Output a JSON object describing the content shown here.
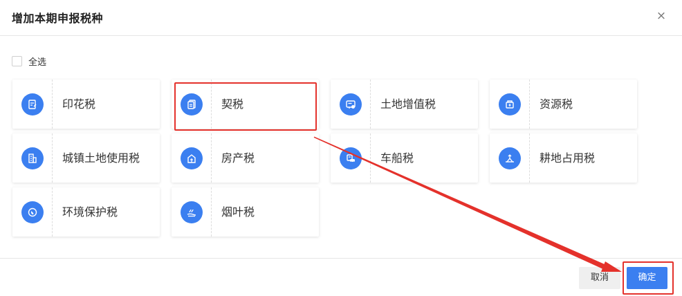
{
  "dialog": {
    "title": "增加本期申报税种",
    "close_glyph": "×"
  },
  "select_all": {
    "label": "全选",
    "checked": false
  },
  "tax_items": [
    {
      "label": "印花税",
      "icon": "stamp-document-icon"
    },
    {
      "label": "契税",
      "icon": "deed-document-icon"
    },
    {
      "label": "土地增值税",
      "icon": "land-value-card-icon"
    },
    {
      "label": "资源税",
      "icon": "resource-box-icon"
    },
    {
      "label": "城镇土地使用税",
      "icon": "urban-building-icon"
    },
    {
      "label": "房产税",
      "icon": "property-house-icon"
    },
    {
      "label": "车船税",
      "icon": "vehicle-vessel-icon"
    },
    {
      "label": "耕地占用税",
      "icon": "farmland-icon"
    },
    {
      "label": "环境保护税",
      "icon": "environment-leaf-icon"
    },
    {
      "label": "烟叶税",
      "icon": "tobacco-leaf-icon"
    }
  ],
  "footer": {
    "cancel_label": "取消",
    "ok_label": "确定"
  },
  "colors": {
    "accent": "#3b7ff0",
    "annotation": "#e4312b"
  }
}
